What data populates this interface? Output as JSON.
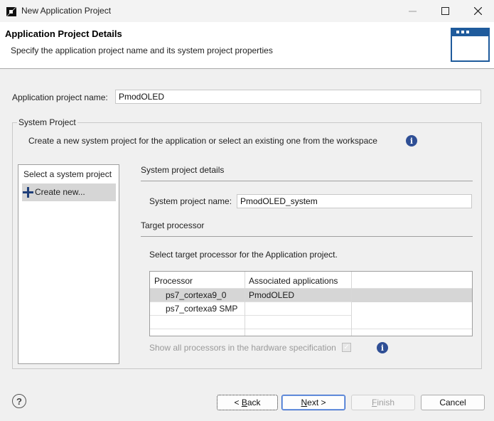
{
  "window": {
    "title": "New Application Project"
  },
  "header": {
    "title": "Application Project Details",
    "subtitle": "Specify the application project name and its system project properties"
  },
  "app_project": {
    "label": "Application project name:",
    "value": "PmodOLED"
  },
  "system_project": {
    "group_label": "System Project",
    "description": "Create a new system project for the application or select an existing one from the workspace",
    "list_header": "Select a system project",
    "list_items": [
      "Create new..."
    ]
  },
  "details": {
    "section_title": "System project details",
    "name_label": "System project name:",
    "name_value": "PmodOLED_system",
    "target_title": "Target processor",
    "target_desc": "Select target processor for the Application project.",
    "table": {
      "columns": [
        "Processor",
        "Associated applications"
      ],
      "rows": [
        {
          "processor": "ps7_cortexa9_0",
          "apps": "PmodOLED",
          "selected": true
        },
        {
          "processor": "ps7_cortexa9 SMP",
          "apps": "",
          "selected": false
        }
      ]
    },
    "show_all_label": "Show all processors in the hardware specification",
    "show_all_checked": true
  },
  "buttons": {
    "back_prefix": "< ",
    "back_mnemonic": "B",
    "back_rest": "ack",
    "next_mnemonic": "N",
    "next_rest": "ext >",
    "finish_mnemonic": "F",
    "finish_rest": "inish",
    "cancel": "Cancel"
  },
  "icons": {
    "help": "?",
    "info": "i",
    "checkmark": "✓",
    "plus": "+"
  },
  "colors": {
    "accent": "#2e62c9",
    "info": "#2f4f95",
    "selection": "#d6d6d6"
  }
}
